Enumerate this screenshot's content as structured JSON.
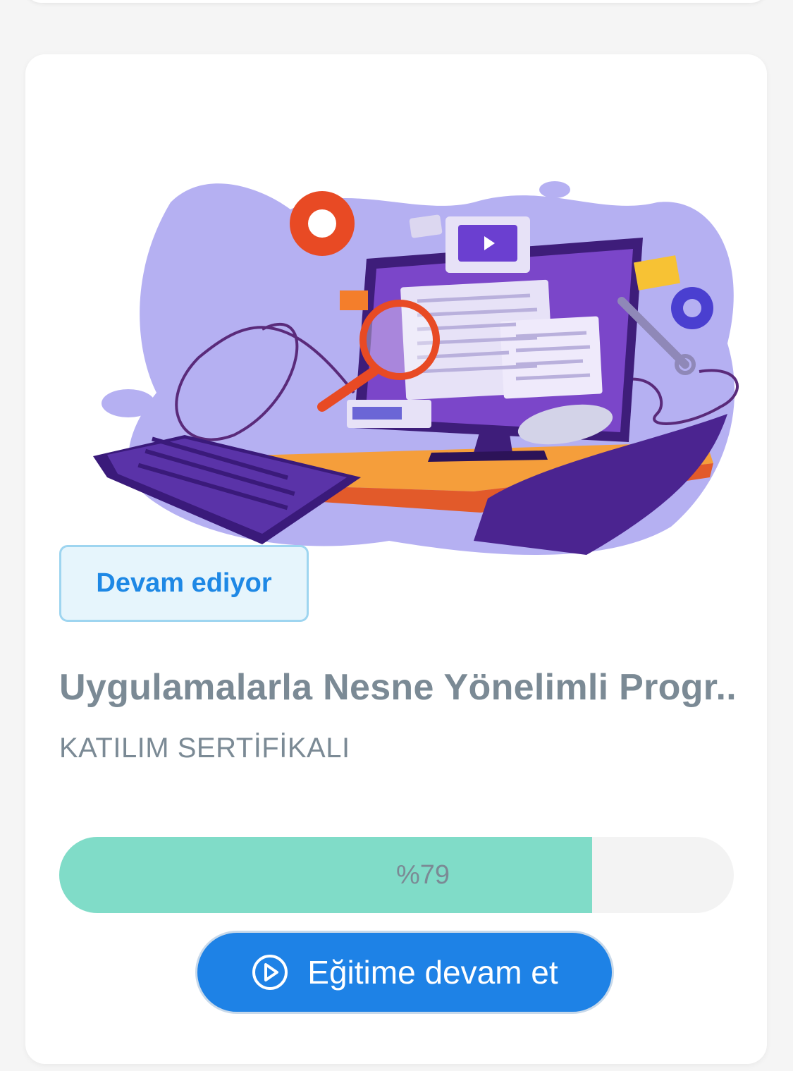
{
  "course_card": {
    "status_label": "Devam ediyor",
    "title": "Uygulamalarla Nesne Yönelimli Progr...",
    "subtitle": "KATILIM SERTİFİKALI",
    "progress": {
      "percent": 79,
      "label": "%79"
    },
    "continue_button_label": "Eğitime devam et",
    "continue_button_icon": "play-circle-icon",
    "illustration": "computer-programming-illustration"
  },
  "colors": {
    "background": "#f5f5f5",
    "card": "#ffffff",
    "status_text": "#1e88e5",
    "status_bg": "#e6f5fc",
    "status_border": "#9ed5f0",
    "title_text": "#7b8a95",
    "progress_fill": "#80dcc8",
    "progress_track": "#f3f3f3",
    "button_bg": "#1e82e6"
  }
}
